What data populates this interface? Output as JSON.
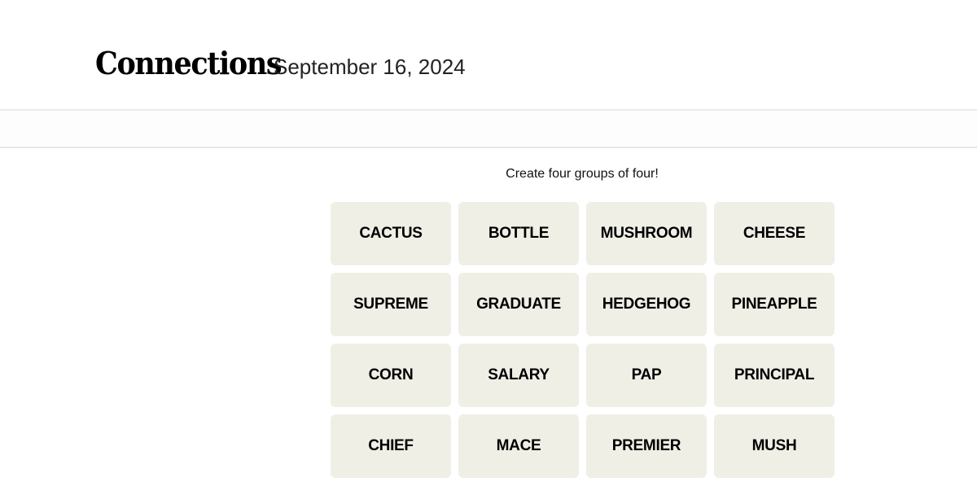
{
  "header": {
    "title": "Connections",
    "date": "September 16, 2024"
  },
  "game": {
    "prompt": "Create four groups of four!",
    "tiles": [
      "CACTUS",
      "BOTTLE",
      "MUSHROOM",
      "CHEESE",
      "SUPREME",
      "GRADUATE",
      "HEDGEHOG",
      "PINEAPPLE",
      "CORN",
      "SALARY",
      "PAP",
      "PRINCIPAL",
      "CHIEF",
      "MACE",
      "PREMIER",
      "MUSH"
    ]
  },
  "colors": {
    "tile_background": "#efefe6",
    "tile_text": "#000000"
  }
}
